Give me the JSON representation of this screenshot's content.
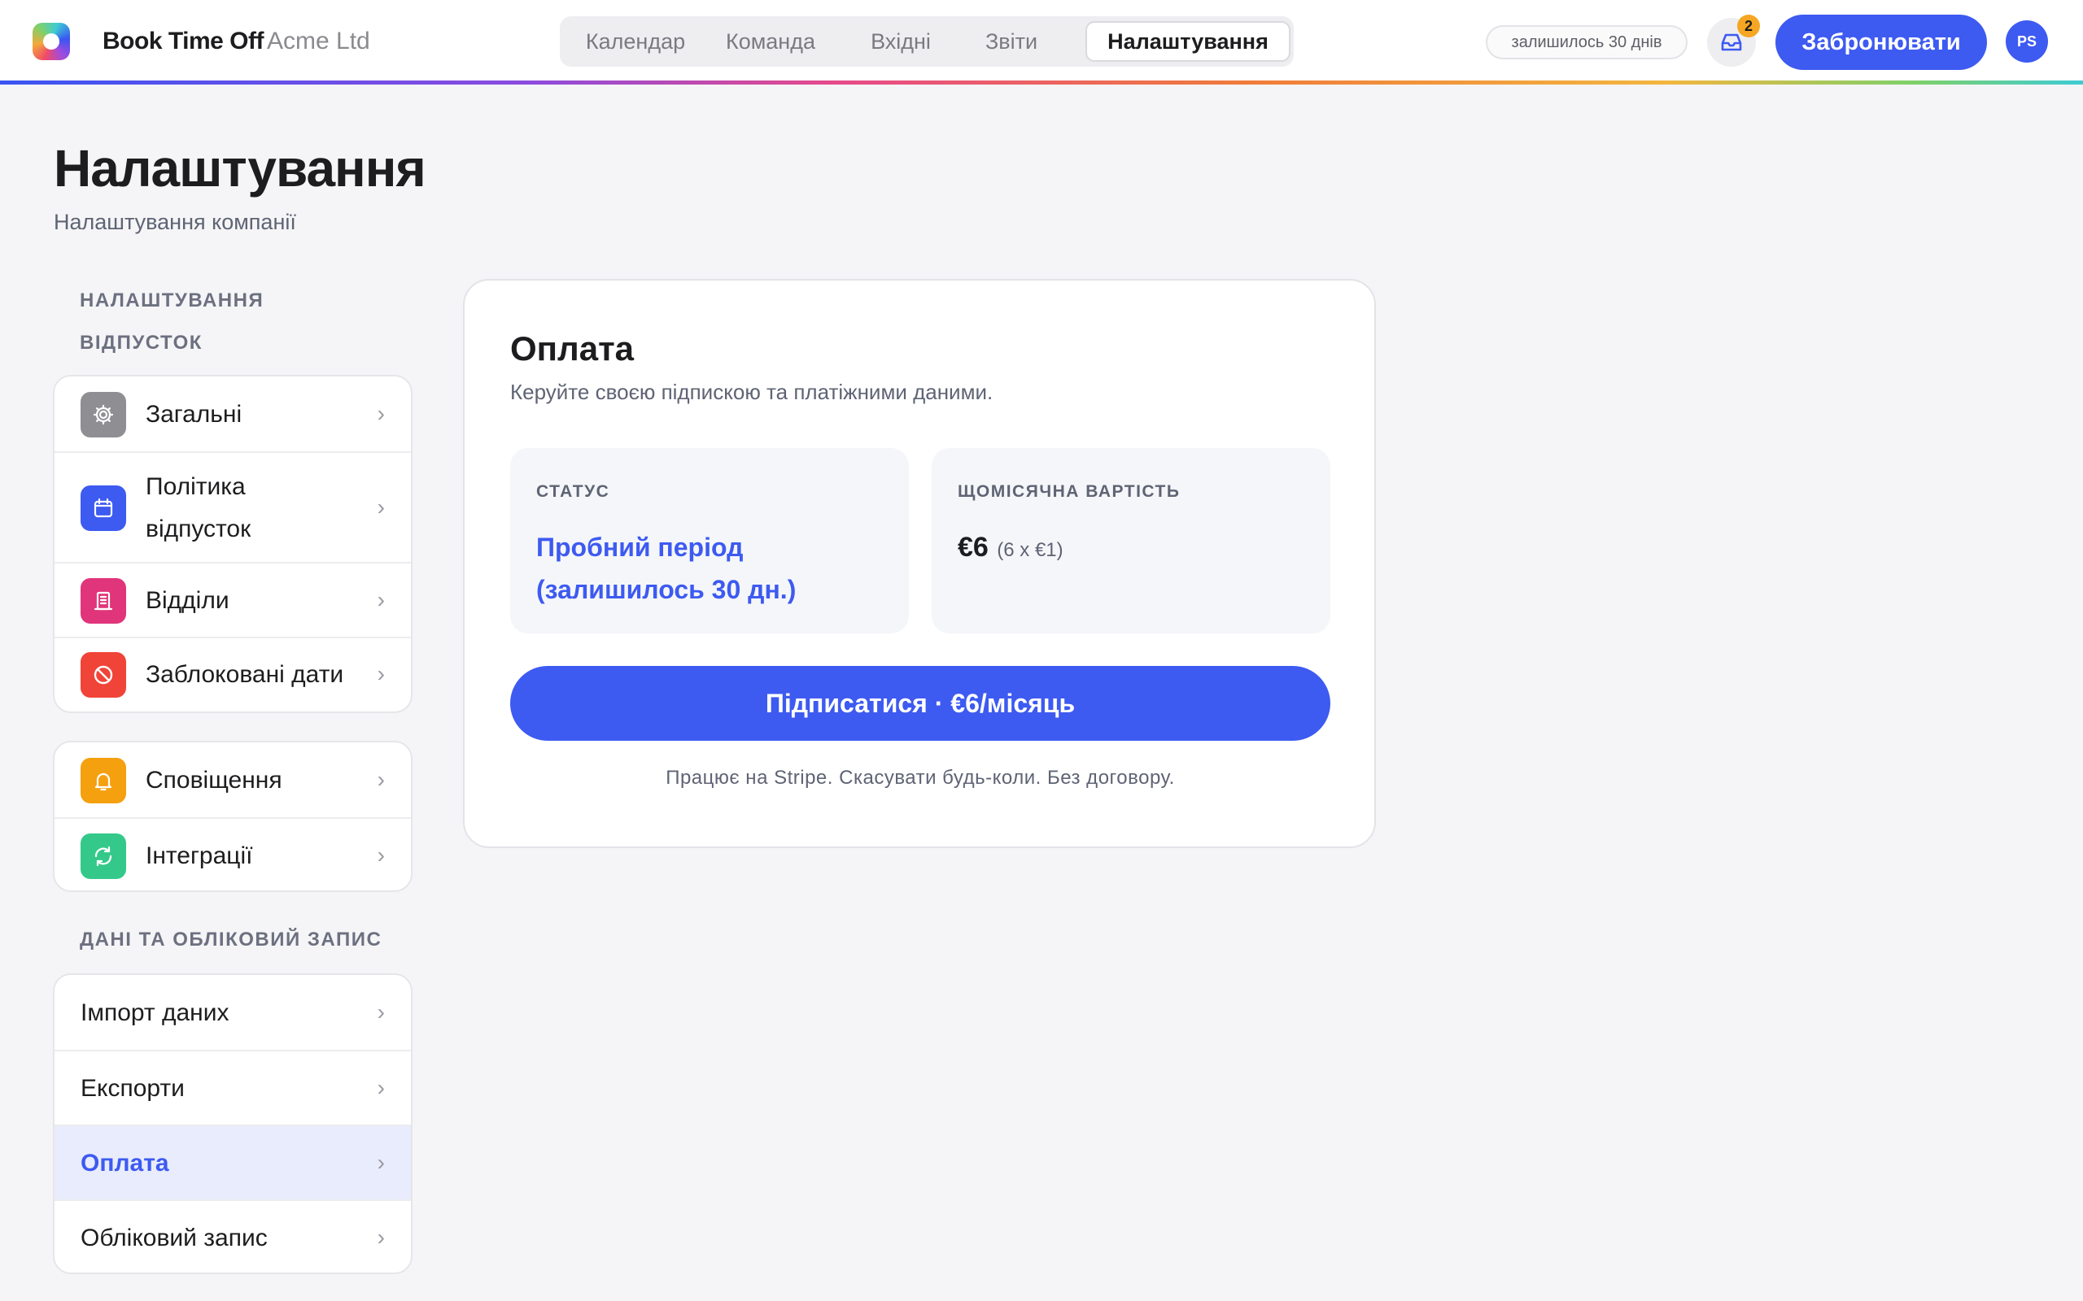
{
  "header": {
    "brand": "Book Time Off",
    "company": "Acme Ltd",
    "tabs": [
      {
        "label": "Календар"
      },
      {
        "label": "Команда"
      },
      {
        "label": "Вхідні"
      },
      {
        "label": "Звіти"
      },
      {
        "label": "Налаштування",
        "active": true
      }
    ],
    "trial_pill": "залишилось 30 днів",
    "inbox_count": "2",
    "book_label": "Забронювати",
    "avatar_initials": "PS"
  },
  "page": {
    "title": "Налаштування",
    "subtitle": "Налаштування компанії"
  },
  "sidebar": {
    "section_leave": [
      "НАЛАШТУВАННЯ",
      "ВІДПУСТОК"
    ],
    "group1": [
      {
        "label": "Загальні",
        "icon": "gear-icon",
        "color": "#8e8e93"
      },
      {
        "label_lines": [
          "Політика",
          "відпусток"
        ],
        "icon": "calendar-icon",
        "color": "#3d5af1"
      },
      {
        "label": "Відділи",
        "icon": "building-icon",
        "color": "#e0357a"
      },
      {
        "label": "Заблоковані дати",
        "icon": "blocked-icon",
        "color": "#f04438"
      }
    ],
    "group2": [
      {
        "label": "Сповіщення",
        "icon": "bell-icon",
        "color": "#f5a00f"
      },
      {
        "label": "Інтеграції",
        "icon": "sync-icon",
        "color": "#34c98a"
      }
    ],
    "section_data": "ДАНІ ТА ОБЛІКОВИЙ ЗАПИС",
    "group3": [
      {
        "label": "Імпорт даних"
      },
      {
        "label": "Експорти"
      },
      {
        "label": "Оплата",
        "active": true
      },
      {
        "label": "Обліковий запис"
      }
    ]
  },
  "billing": {
    "title": "Оплата",
    "description": "Керуйте своєю підпискою та платіжними даними.",
    "status_label": "СТАТУС",
    "status_lines": [
      "Пробний період",
      "(залишилось 30 дн.)"
    ],
    "cost_label": "ЩОМІСЯЧНА ВАРТІСТЬ",
    "cost_amount": "€6",
    "cost_calc": "(6 x €1)",
    "subscribe_label": "Підписатися · €6/місяць",
    "footnote": "Працює на Stripe. Скасувати будь-коли. Без договору."
  },
  "colors": {
    "accent": "#3d5af1",
    "badge": "#f5a623",
    "active_bg": "#e9ecfd"
  }
}
